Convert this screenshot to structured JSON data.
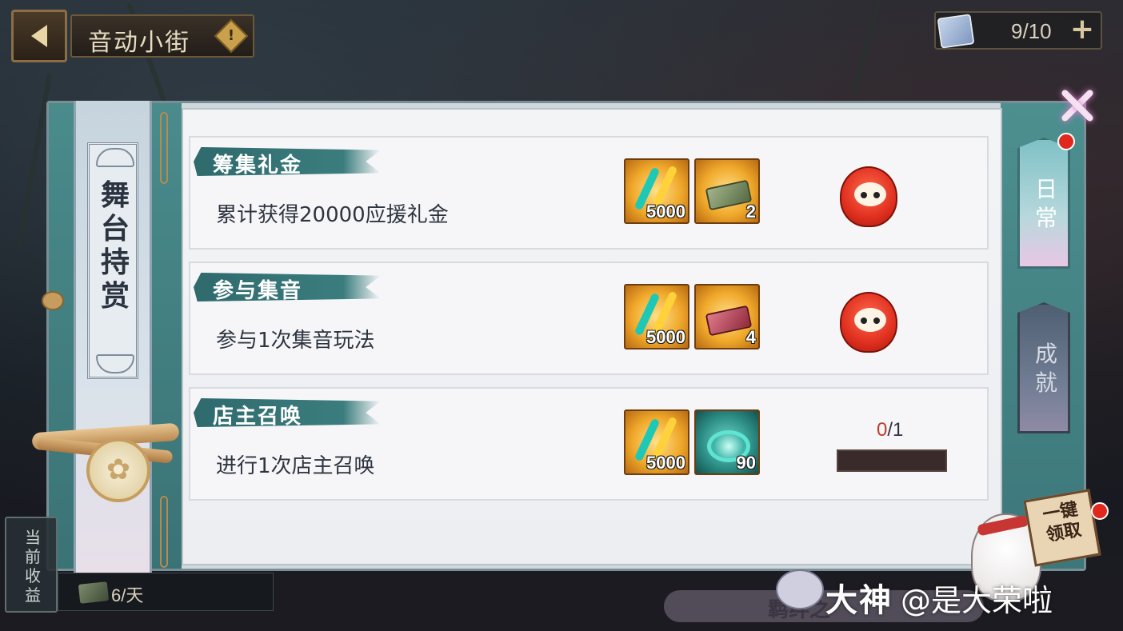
{
  "header": {
    "back_label": "",
    "title": "音动小街",
    "warn_glyph": "!",
    "ticket_count": "9/10",
    "plus_label": "+"
  },
  "banner": {
    "title_chars": [
      "舞",
      "台",
      "持",
      "赏"
    ],
    "medallion_glyph": "✿"
  },
  "tasks": [
    {
      "title": "筹集礼金",
      "desc": "累计获得20000应援礼金",
      "rewards": [
        {
          "icon": "glowstick-icon",
          "qty": "5000"
        },
        {
          "icon": "green-gift-box-icon",
          "qty": "2"
        }
      ],
      "status": "daruma-reward-icon"
    },
    {
      "title": "参与集音",
      "desc": "参与1次集音玩法",
      "rewards": [
        {
          "icon": "glowstick-icon",
          "qty": "5000"
        },
        {
          "icon": "red-gift-box-icon",
          "qty": "4"
        }
      ],
      "status": "daruma-reward-icon"
    },
    {
      "title": "店主召唤",
      "desc": "进行1次店主召唤",
      "rewards": [
        {
          "icon": "glowstick-icon",
          "qty": "5000"
        },
        {
          "icon": "music-note-swirl-icon",
          "qty": "90"
        }
      ],
      "progress": {
        "current": "0",
        "total": "/1",
        "fraction": 0
      }
    }
  ],
  "tabs": {
    "daily": [
      "日",
      "常"
    ],
    "achievement": [
      "成",
      "就"
    ]
  },
  "claim_all": [
    "一键",
    "领取"
  ],
  "bottom": {
    "income_label": [
      "当",
      "前",
      "收",
      "益"
    ],
    "income_rate": "6/天",
    "bond_text": "羁绊之"
  },
  "watermark": {
    "brand": "大神",
    "user": "@是大荣啦"
  },
  "colors": {
    "teal": "#3b7d7e",
    "reward_gold": "#f0a92b",
    "red_dot": "#e0281e",
    "progress_current": "#c0392b"
  }
}
